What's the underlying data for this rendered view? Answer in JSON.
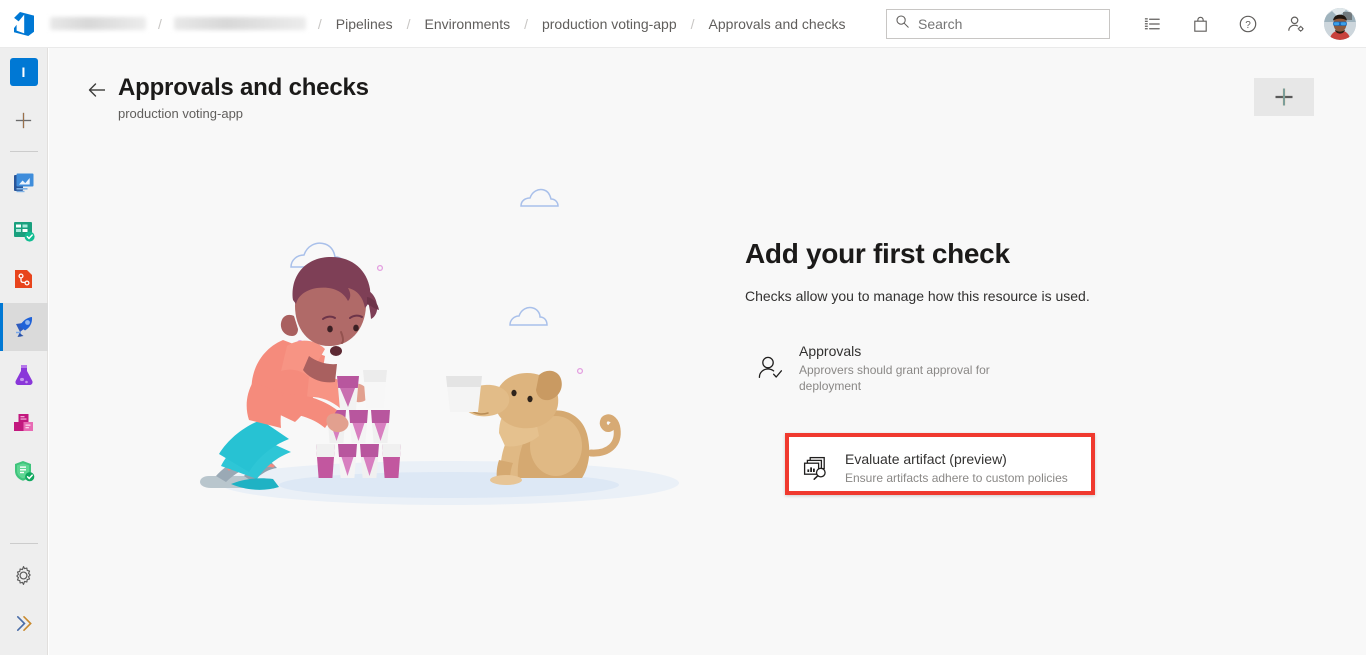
{
  "topbar": {
    "logo_icon": "azure-devops-logo",
    "breadcrumb": [
      {
        "label": "",
        "redacted": true,
        "width": 96
      },
      {
        "label": "",
        "redacted": true,
        "width": 132
      },
      {
        "label": "Pipelines",
        "redacted": false
      },
      {
        "label": "Environments",
        "redacted": false
      },
      {
        "label": "production voting-app",
        "redacted": false
      },
      {
        "label": "Approvals and checks",
        "redacted": false
      }
    ],
    "separator": "/",
    "search": {
      "placeholder": "Search",
      "value": "",
      "icon": "search-icon"
    },
    "icons": [
      {
        "name": "boards-list-icon",
        "glyph": "list"
      },
      {
        "name": "marketplace-bag-icon",
        "glyph": "bag"
      },
      {
        "name": "help-question-icon",
        "glyph": "question"
      },
      {
        "name": "user-settings-icon",
        "glyph": "person-gear"
      }
    ],
    "avatar": {
      "name": "user-avatar",
      "alt": "User profile photo"
    }
  },
  "sidebar": {
    "items": [
      {
        "name": "project-initial",
        "label": "I",
        "type": "project-avatar",
        "color": "#0078d4",
        "active": false
      },
      {
        "name": "new-project-plus",
        "label": "+",
        "type": "plus",
        "active": false
      },
      {
        "name": "overview",
        "label": "Overview",
        "type": "icon",
        "active": false
      },
      {
        "name": "boards",
        "label": "Boards",
        "type": "icon",
        "active": false
      },
      {
        "name": "repos",
        "label": "Repos",
        "type": "icon",
        "active": false
      },
      {
        "name": "pipelines",
        "label": "Pipelines",
        "type": "icon",
        "active": true
      },
      {
        "name": "test-plans",
        "label": "Test Plans",
        "type": "icon",
        "active": false
      },
      {
        "name": "artifacts",
        "label": "Artifacts",
        "type": "icon",
        "active": false
      },
      {
        "name": "advanced-security",
        "label": "Advanced Security",
        "type": "icon",
        "active": false
      }
    ],
    "bottom_items": [
      {
        "name": "project-settings",
        "label": "Project settings",
        "type": "gear"
      },
      {
        "name": "expand-sidebar",
        "label": "Expand",
        "type": "chevrons-right"
      }
    ]
  },
  "page": {
    "back_label": "Back",
    "title": "Approvals and checks",
    "subtitle": "production voting-app",
    "add_button_label": "+",
    "add_button_name": "add-check-button"
  },
  "empty_state": {
    "title": "Add your first check",
    "description": "Checks allow you to manage how this resource is used.",
    "illustration_alt": "Person stacking cups with a dog watching"
  },
  "checks": [
    {
      "name": "Approvals",
      "description": "Approvers should grant approval for deployment",
      "icon": "person-check-icon",
      "highlighted": false
    },
    {
      "name": "Evaluate artifact (preview)",
      "description": "Ensure artifacts adhere to custom policies",
      "icon": "evaluate-artifact-icon",
      "highlighted": true
    }
  ],
  "colors": {
    "accent": "#0078d4",
    "highlight_border": "#f03a2f",
    "page_background": "#f8f8f8",
    "rail_background": "#eeeeee",
    "text_primary": "#1b1a19",
    "text_secondary": "#605e5c",
    "text_muted": "#8a8886"
  }
}
